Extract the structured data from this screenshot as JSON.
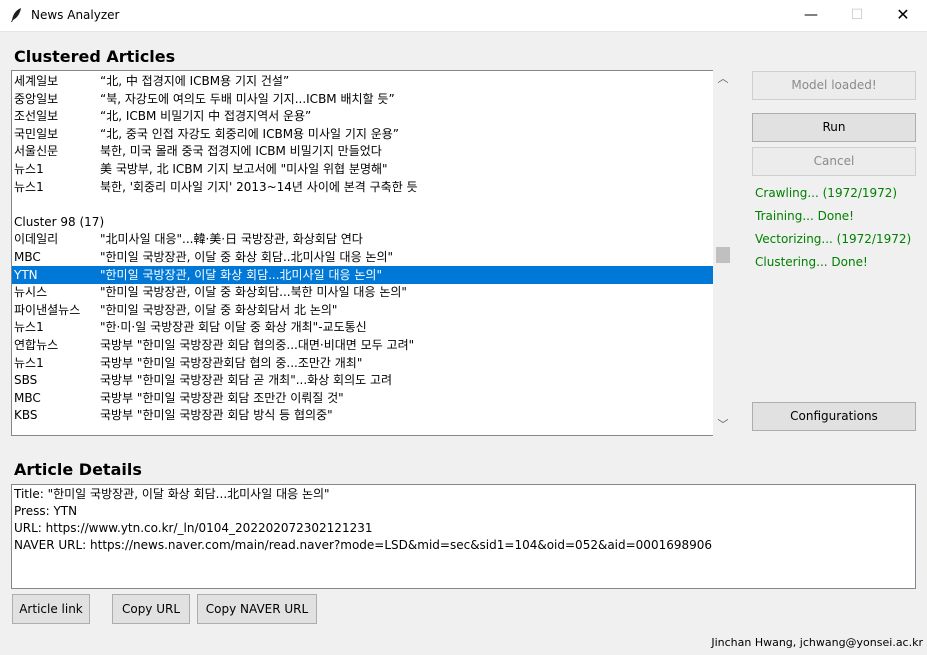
{
  "window": {
    "title": "News Analyzer",
    "min_glyph": "—",
    "max_glyph": "☐",
    "close_glyph": "✕"
  },
  "clustered_title": "Clustered Articles",
  "details_title": "Article Details",
  "list_rows": [
    {
      "press": "세계일보",
      "headline": "“北, 中 접경지에 ICBM용 기지 건설”"
    },
    {
      "press": "중앙일보",
      "headline": "“북, 자강도에 여의도 두배 미사일 기지...ICBM 배치할 듯”"
    },
    {
      "press": "조선일보",
      "headline": "“北, ICBM 비밀기지 中 접경지역서 운용”"
    },
    {
      "press": "국민일보",
      "headline": "“北, 중국 인접 자강도 회중리에 ICBM용 미사일 기지 운용”"
    },
    {
      "press": "서울신문",
      "headline": "북한, 미국 몰래 중국 접경지에 ICBM 비밀기지 만들었다"
    },
    {
      "press": "뉴스1",
      "headline": "美 국방부, 北 ICBM 기지 보고서에 \"미사일 위협 분명해\""
    },
    {
      "press": "뉴스1",
      "headline": "북한, '회중리 미사일 기지' 2013~14년 사이에 본격 구축한 듯"
    },
    {
      "press": "",
      "headline": ""
    },
    {
      "press": "Cluster 98 (17)",
      "headline": ""
    },
    {
      "press": "이데일리",
      "headline": "\"北미사일 대응\"...韓·美·日 국방장관, 화상회담 연다"
    },
    {
      "press": "MBC",
      "headline": "\"한미일 국방장관, 이달 중 화상 회담..北미사일 대응 논의\""
    },
    {
      "press": "YTN",
      "headline": "\"한미일 국방장관, 이달 화상 회담...北미사일 대응 논의\""
    },
    {
      "press": "뉴시스",
      "headline": "\"한미일 국방장관, 이달 중 화상회담...북한 미사일 대응 논의\""
    },
    {
      "press": "파이낸셜뉴스",
      "headline": "\"한미일 국방장관, 이달 중 화상회담서 北 논의\""
    },
    {
      "press": "뉴스1",
      "headline": "\"한·미·일 국방장관 회담 이달 중 화상 개최\"-교도통신"
    },
    {
      "press": "연합뉴스",
      "headline": "국방부 \"한미일 국방장관 회담 협의중...대면·비대면 모두 고려\""
    },
    {
      "press": "뉴스1",
      "headline": "국방부 \"한미일 국방장관회담 협의 중...조만간 개최\""
    },
    {
      "press": "SBS",
      "headline": "국방부 \"한미일 국방장관 회담 곧 개최\"...화상 회의도 고려"
    },
    {
      "press": "MBC",
      "headline": "국방부 \"한미일 국방장관 회담 조만간 이뤄질 것\""
    },
    {
      "press": "KBS",
      "headline": "국방부 \"한미일 국방장관 회담 방식 등 협의중\""
    }
  ],
  "selected_row_index": 11,
  "buttons": {
    "model_loaded": "Model loaded!",
    "run": "Run",
    "cancel": "Cancel",
    "configurations": "Configurations",
    "article_link": "Article link",
    "copy_url": "Copy URL",
    "copy_naver_url": "Copy NAVER URL"
  },
  "status": [
    "Crawling... (1972/1972)",
    "Training... Done!",
    "Vectorizing... (1972/1972)",
    "Clustering... Done!"
  ],
  "details": {
    "title_line": "Title: \"한미일 국방장관, 이달 화상 회담...北미사일 대응 논의\"",
    "press_line": "Press: YTN",
    "url_line": "URL: https://www.ytn.co.kr/_ln/0104_202202072302121231",
    "naver_line": "NAVER URL: https://news.naver.com/main/read.naver?mode=LSD&mid=sec&sid1=104&oid=052&aid=0001698906"
  },
  "footer": "Jinchan Hwang, jchwang@yonsei.ac.kr",
  "colors": {
    "selection": "#0078d7",
    "status_green": "#008000"
  },
  "icons": {
    "app": "feather-icon",
    "scroll_up": "chevron-up-icon",
    "scroll_down": "chevron-down-icon"
  }
}
